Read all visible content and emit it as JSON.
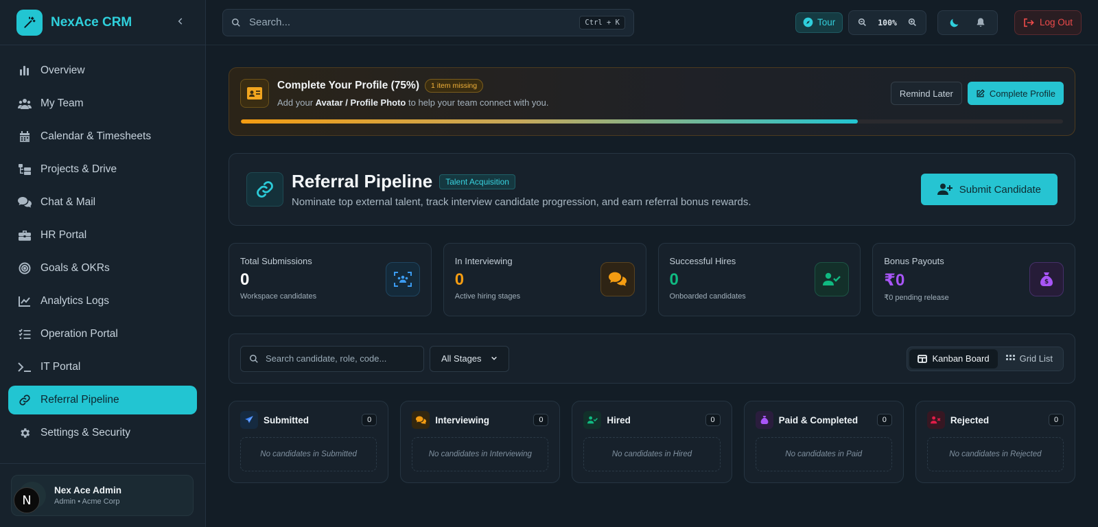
{
  "app": {
    "name": "NexAce CRM"
  },
  "sidebar": {
    "items": [
      {
        "label": "Overview",
        "icon": "bar-chart-icon"
      },
      {
        "label": "My Team",
        "icon": "users-icon"
      },
      {
        "label": "Calendar & Timesheets",
        "icon": "calendar-icon"
      },
      {
        "label": "Projects & Drive",
        "icon": "folder-tree-icon"
      },
      {
        "label": "Chat & Mail",
        "icon": "chat-icon"
      },
      {
        "label": "HR Portal",
        "icon": "briefcase-icon"
      },
      {
        "label": "Goals & OKRs",
        "icon": "target-icon"
      },
      {
        "label": "Analytics Logs",
        "icon": "line-chart-icon"
      },
      {
        "label": "Operation Portal",
        "icon": "list-check-icon"
      },
      {
        "label": "IT Portal",
        "icon": "terminal-icon"
      },
      {
        "label": "Referral Pipeline",
        "icon": "link-icon",
        "active": true
      },
      {
        "label": "Settings & Security",
        "icon": "gear-icon"
      }
    ],
    "user": {
      "name": "Nex Ace Admin",
      "role": "Admin • Acme Corp",
      "badge": "N"
    }
  },
  "topbar": {
    "search_placeholder": "Search...",
    "shortcut": "Ctrl + K",
    "tour_label": "Tour",
    "zoom": "100%",
    "logout_label": "Log Out"
  },
  "profile_banner": {
    "title": "Complete Your Profile (75%)",
    "badge": "1 item missing",
    "sub_prefix": "Add your ",
    "sub_bold": "Avatar / Profile Photo",
    "sub_suffix": " to help your team connect with you.",
    "remind_label": "Remind Later",
    "complete_label": "Complete Profile",
    "progress": 0.75
  },
  "header": {
    "title": "Referral Pipeline",
    "tag": "Talent Acquisition",
    "subtitle": "Nominate top external talent, track interview candidate progression, and earn referral bonus rewards.",
    "submit_label": "Submit Candidate"
  },
  "stats": [
    {
      "label": "Total Submissions",
      "value": "0",
      "sub": "Workspace candidates",
      "color": "#ffffff",
      "icon": "users-scan-icon"
    },
    {
      "label": "In Interviewing",
      "value": "0",
      "sub": "Active hiring stages",
      "color": "#f39c12",
      "icon": "chat-icon"
    },
    {
      "label": "Successful Hires",
      "value": "0",
      "sub": "Onboarded candidates",
      "color": "#10b981",
      "icon": "user-check-icon"
    },
    {
      "label": "Bonus Payouts",
      "value": "₹0",
      "sub": "₹0 pending release",
      "color": "#a855f7",
      "icon": "money-bag-icon"
    }
  ],
  "filters": {
    "search_placeholder": "Search candidate, role, code...",
    "stage": "All Stages",
    "views": [
      {
        "label": "Kanban Board",
        "active": true
      },
      {
        "label": "Grid List",
        "active": false
      }
    ]
  },
  "kanban": [
    {
      "title": "Submitted",
      "count": "0",
      "empty": "No candidates in Submitted",
      "color": "#3b82f6"
    },
    {
      "title": "Interviewing",
      "count": "0",
      "empty": "No candidates in Interviewing",
      "color": "#f39c12"
    },
    {
      "title": "Hired",
      "count": "0",
      "empty": "No candidates in Hired",
      "color": "#10b981"
    },
    {
      "title": "Paid & Completed",
      "count": "0",
      "empty": "No candidates in Paid",
      "color": "#a855f7"
    },
    {
      "title": "Rejected",
      "count": "0",
      "empty": "No candidates in Rejected",
      "color": "#e11d48"
    }
  ]
}
